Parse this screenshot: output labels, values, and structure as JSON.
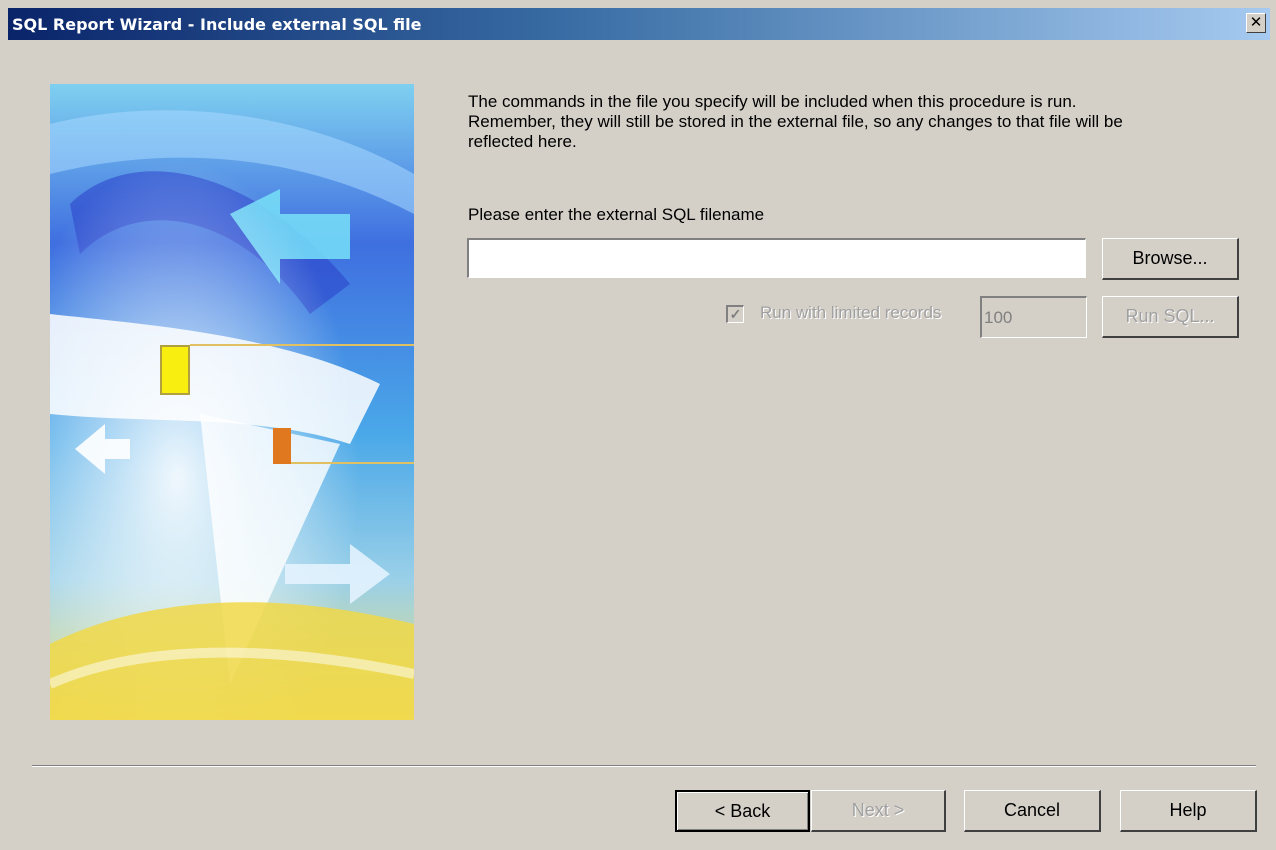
{
  "window": {
    "title": "SQL Report Wizard - Include external SQL file",
    "close_glyph": "✕"
  },
  "intro": {
    "line1": "The commands in the file you specify will be included when this procedure is run.",
    "line2": "Remember, they will still be stored in the external file, so any changes to that file will be",
    "line3": "reflected here."
  },
  "filename": {
    "label": "Please enter the external SQL filename",
    "value": "",
    "browse_label": "Browse..."
  },
  "limited": {
    "checked": true,
    "check_glyph": "✓",
    "label": "Run with limited records",
    "records": "100",
    "run_sql_label": "Run SQL..."
  },
  "nav": {
    "back_label": "< Back",
    "next_label": "Next >",
    "cancel_label": "Cancel",
    "help_label": "Help"
  },
  "colors": {
    "face": "#d4d0c8",
    "title_start": "#0a246a",
    "title_end": "#a6caf0",
    "disabled_text": "#a0a0a0"
  },
  "icons": {
    "close": "close-icon",
    "check": "checkmark-icon"
  }
}
